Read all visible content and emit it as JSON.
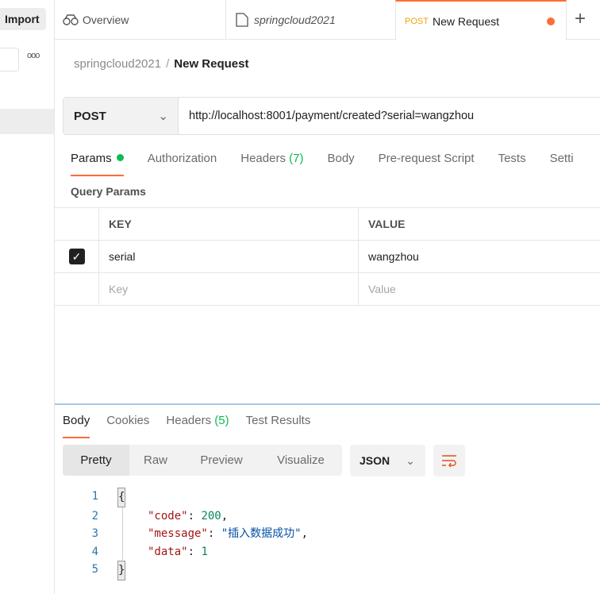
{
  "sidebar": {
    "import_label": "Import",
    "more_icon": "more-horizontal-icon"
  },
  "tabs": [
    {
      "label": "Overview",
      "icon": "binoculars-icon"
    },
    {
      "label": "springcloud2021",
      "icon": "collection-icon"
    },
    {
      "method": "POST",
      "label": "New Request",
      "unsaved": true,
      "active": true
    }
  ],
  "breadcrumb": {
    "parent": "springcloud2021",
    "separator": "/",
    "current": "New Request"
  },
  "request": {
    "method": "POST",
    "url": "http://localhost:8001/payment/created?serial=wangzhou"
  },
  "request_tabs": [
    {
      "label": "Params"
    },
    {
      "label": "Authorization"
    },
    {
      "label": "Headers",
      "count": "(7)"
    },
    {
      "label": "Body"
    },
    {
      "label": "Pre-request Script"
    },
    {
      "label": "Tests"
    },
    {
      "label": "Setti"
    }
  ],
  "query_params": {
    "title": "Query Params",
    "headers": [
      "KEY",
      "VALUE"
    ],
    "rows": [
      {
        "checked": true,
        "key": "serial",
        "value": "wangzhou"
      }
    ],
    "placeholder_key": "Key",
    "placeholder_value": "Value"
  },
  "response_tabs": [
    {
      "label": "Body"
    },
    {
      "label": "Cookies"
    },
    {
      "label": "Headers",
      "count": "(5)"
    },
    {
      "label": "Test Results"
    }
  ],
  "view_modes": [
    "Pretty",
    "Raw",
    "Preview",
    "Visualize"
  ],
  "format": "JSON",
  "code": {
    "l1": "{",
    "key_code": "\"code\"",
    "val_code": "200",
    "key_message": "\"message\"",
    "val_message": "\"插入数据成功\"",
    "key_data": "\"data\"",
    "val_data": "1",
    "l5": "}",
    "lines": [
      "1",
      "2",
      "3",
      "4",
      "5"
    ]
  },
  "colors": {
    "accent": "#ff6c37",
    "success": "#0cbb52",
    "method_tab": "#f2a20a"
  }
}
